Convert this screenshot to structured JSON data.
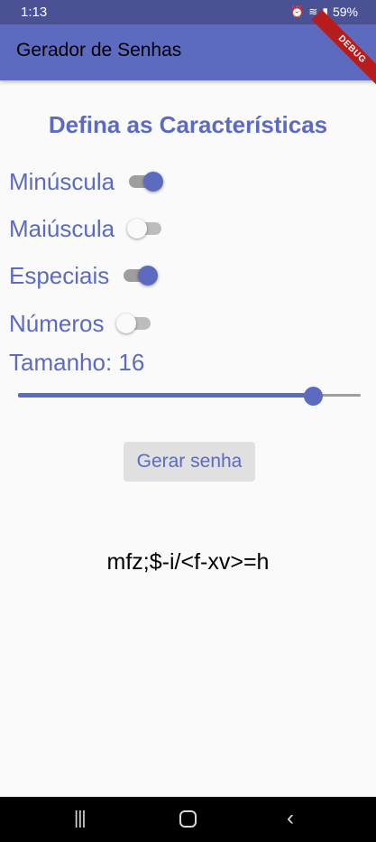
{
  "status_bar": {
    "time": "1:13",
    "battery": "59%",
    "icons": [
      "alarm-icon",
      "wifi-icon",
      "signal-icon",
      "battery-icon"
    ]
  },
  "app_bar": {
    "title": "Gerador de Senhas",
    "debug_banner": "DEBUG",
    "color": "#5c6bc0"
  },
  "main": {
    "heading": "Defina as Características",
    "options": [
      {
        "label": "Minúscula",
        "enabled": true
      },
      {
        "label": "Maiúscula",
        "enabled": false
      },
      {
        "label": "Especiais",
        "enabled": true
      },
      {
        "label": "Números",
        "enabled": false
      }
    ],
    "size_label": "Tamanho: 16",
    "slider_fraction": 0.86,
    "generate_button": "Gerar senha",
    "password": "mfz;$-i/<f-xv>=h",
    "accent_color": "#5c6bc0"
  },
  "nav_bar": {
    "recent_glyph": "|||",
    "back_glyph": "‹"
  }
}
